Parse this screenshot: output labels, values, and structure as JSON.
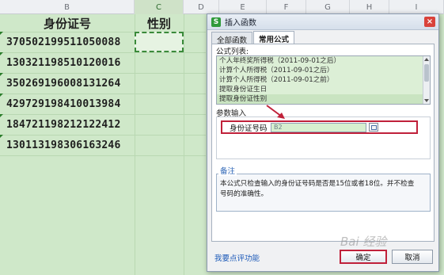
{
  "sheet": {
    "columns": [
      "B",
      "C",
      "D",
      "E",
      "F",
      "G",
      "H",
      "I"
    ],
    "header_row": {
      "id_label": "身份证号",
      "gender_label": "性别"
    },
    "rows": [
      "370502199511050088",
      "130321198510120016",
      "350269196008131264",
      "429729198410013984",
      "184721198212122412",
      "130113198306163246"
    ]
  },
  "dialog": {
    "title": "插入函数",
    "app_icon": "S",
    "close_label": "×",
    "tabs": [
      "全部函数",
      "常用公式"
    ],
    "list_label": "公式列表:",
    "formulas": [
      "个人年终奖所得税（2011-09-01之后）",
      "计算个人所得税（2011-09-01之后）",
      "计算个人所得税（2011-09-01之前）",
      "提取身份证生日",
      "提取身份证性别"
    ],
    "param_section_label": "参数输入",
    "param_label": "身份证号码",
    "param_value": "B2",
    "note_title": "备注",
    "note_text": "本公式只检查输入的身份证号码是否是15位或者18位。并不检查号码的准确性。",
    "feedback_link": "我要点评功能",
    "ok_label": "确定",
    "cancel_label": "取消"
  },
  "watermark": "Bai 经验",
  "accent_colors": {
    "highlight_red": "#c0213a",
    "sheet_green": "#cfe8c9",
    "link_blue": "#1b59b8"
  }
}
